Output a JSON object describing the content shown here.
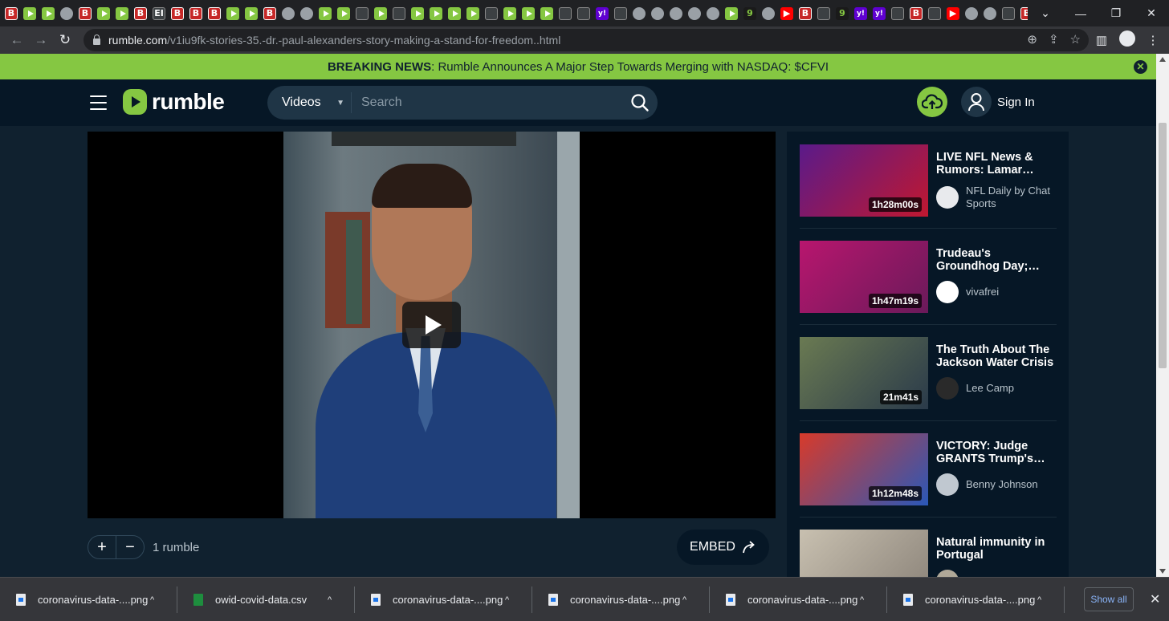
{
  "browser": {
    "url_host": "rumble.com",
    "url_path": "/v1iu9fk-stories-35.-dr.-paul-alexanders-story-making-a-stand-for-freedom..html",
    "tab_icons": [
      "b",
      "r",
      "r",
      "g",
      "b",
      "r",
      "r",
      "b",
      "EI",
      "b",
      "b",
      "b",
      "r",
      "r",
      "b",
      "g",
      "g",
      "r",
      "r",
      "gr",
      "r",
      "gr",
      "r",
      "r",
      "r",
      "r",
      "gr",
      "r",
      "r",
      "r",
      "gr",
      "gr",
      "y",
      "gr",
      "g",
      "g",
      "g",
      "g",
      "g",
      "r",
      "n9",
      "g",
      "yt",
      "b",
      "gr",
      "n9",
      "y",
      "y",
      "gr",
      "b",
      "gr",
      "yt",
      "g",
      "g",
      "gr",
      "b",
      "yt",
      "yt",
      "gr",
      "gr"
    ],
    "active_tab_close": "×",
    "after_tabs": [
      "b",
      "b",
      "n9",
      "y",
      "yt"
    ]
  },
  "banner": {
    "label": "BREAKING NEWS",
    "text": ": Rumble Announces A Major Step Towards Merging with NASDAQ: $CFVI"
  },
  "header": {
    "logo_text": "rumble",
    "search_category": "Videos",
    "search_placeholder": "Search",
    "signin_label": "Sign In"
  },
  "video": {
    "rumble_count": "1 rumble",
    "embed_label": "EMBED",
    "vote_up": "+",
    "vote_down": "−"
  },
  "recommendations": [
    {
      "title": "LIVE NFL News & Rumors: Lamar…",
      "channel": "NFL Daily by Chat Sports",
      "duration": "1h28m00s",
      "thumb_colors": [
        "#5a1a8a",
        "#c01830"
      ],
      "avatar_color": "#e8eaed"
    },
    {
      "title": "Trudeau's Groundhog Day;…",
      "channel": "vivafrei",
      "duration": "1h47m19s",
      "thumb_colors": [
        "#b8166e",
        "#6a1a5a"
      ],
      "avatar_color": "#ffffff"
    },
    {
      "title": "The Truth About The Jackson Water Crisis",
      "channel": "Lee Camp",
      "duration": "21m41s",
      "thumb_colors": [
        "#6a7a52",
        "#2a3a4a"
      ],
      "avatar_color": "#2a2a2a"
    },
    {
      "title": "VICTORY: Judge GRANTS Trump's…",
      "channel": "Benny Johnson",
      "duration": "1h12m48s",
      "thumb_colors": [
        "#d83a2a",
        "#2a58b8"
      ],
      "avatar_color": "#c0c8d0"
    },
    {
      "title": "Natural immunity in Portugal",
      "channel": "",
      "duration": "",
      "thumb_colors": [
        "#c8c0b0",
        "#8a8278"
      ],
      "avatar_color": "#b0a898"
    }
  ],
  "downloads": {
    "items": [
      {
        "name": "coronavirus-data-....png",
        "type": "png"
      },
      {
        "name": "owid-covid-data.csv",
        "type": "csv"
      },
      {
        "name": "coronavirus-data-....png",
        "type": "png"
      },
      {
        "name": "coronavirus-data-....png",
        "type": "png"
      },
      {
        "name": "coronavirus-data-....png",
        "type": "png"
      },
      {
        "name": "coronavirus-data-....png",
        "type": "png"
      }
    ],
    "show_all": "Show all"
  }
}
